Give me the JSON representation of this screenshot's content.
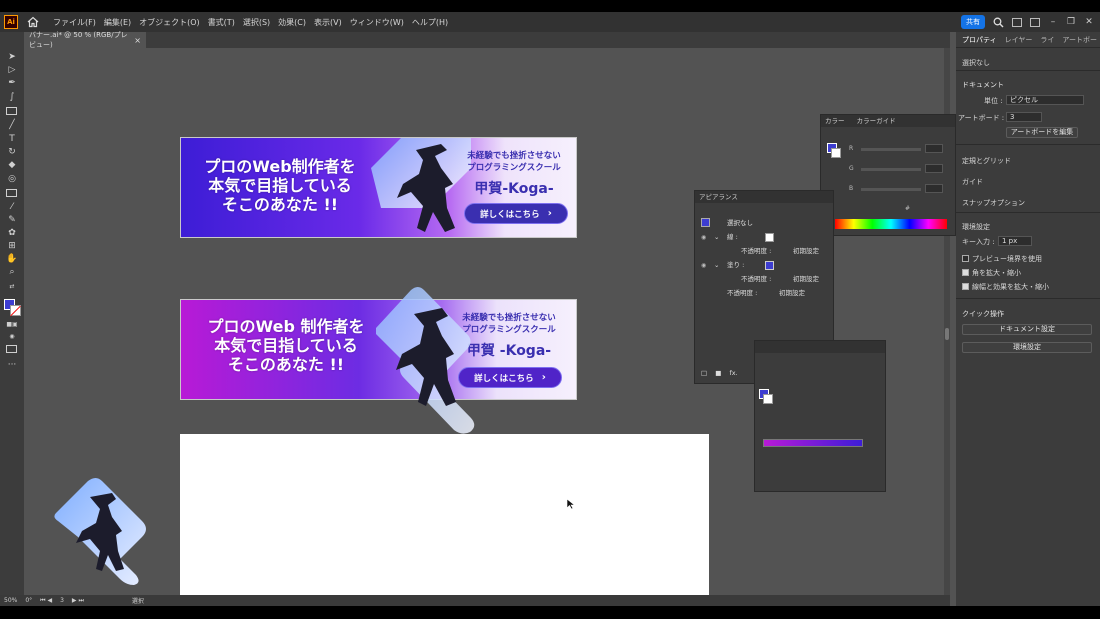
{
  "menu": {
    "logo": "Ai",
    "items": [
      "ファイル(F)",
      "編集(E)",
      "オブジェクト(O)",
      "書式(T)",
      "選択(S)",
      "効果(C)",
      "表示(V)",
      "ウィンドウ(W)",
      "ヘルプ(H)"
    ],
    "share": "共有"
  },
  "document_tab": {
    "title": "バナー.ai* @ 50 % (RGB/プレビュー)",
    "close": "×"
  },
  "banner1": {
    "headline_1": "プロのWeb制作者を",
    "headline_2": "本気で目指している",
    "headline_3": "そこのあなた !!",
    "sub_1": "未経験でも挫折させない",
    "sub_2": "プログラミングスクール",
    "brand": "甲賀-Koga-",
    "cta": "詳しくはこちら"
  },
  "banner2": {
    "headline_1": "プロのWeb 制作者を",
    "headline_2": "本気で目指している",
    "headline_3": "そこのあなた !!",
    "sub_1": "未経験でも挫折させない",
    "sub_2": "プログラミングスクール",
    "brand": "甲賀 -Koga-",
    "cta": "詳しくはこちら"
  },
  "status": {
    "zoom": "50%",
    "rotation": "0°",
    "artboard": "3",
    "tool": "選択"
  },
  "properties": {
    "tabs": [
      "プロパティ",
      "レイヤー",
      "ライ",
      "アートボー"
    ],
    "selection": "選択なし",
    "document_title": "ドキュメント",
    "unit_label": "単位 :",
    "unit_value": "ピクセル",
    "artboard_label": "アートボード :",
    "artboard_value": "3",
    "edit_artboards": "アートボードを編集",
    "ruler_grid": "定規とグリッド",
    "guide": "ガイド",
    "snap": "スナップオプション",
    "prefs": "環境設定",
    "key_increment_label": "キー入力 :",
    "key_increment_value": "1 px",
    "preview_bounds": "プレビュー境界を使用",
    "scale_corners": "角を拡大・縮小",
    "scale_strokes": "線幅と効果を拡大・縮小",
    "quick_actions": "クイック操作",
    "doc_setup": "ドキュメント設定",
    "prefs_button": "環境設定"
  },
  "color_panel": {
    "tab_color": "カラー",
    "tab_guide": "カラーガイド",
    "r": "R",
    "g": "G",
    "b": "B",
    "hash": "#"
  },
  "appearance_panel": {
    "title": "アピアランス",
    "selection": "選択なし",
    "stroke": "線 :",
    "opacity": "不透明度 :",
    "default": "初期設定",
    "fill": "塗り :",
    "fx": "fx."
  },
  "colors": {
    "accent": "#3d1dd6",
    "magenta": "#b81ad6",
    "canvas": "#535353",
    "panel": "#3c3c3c"
  }
}
